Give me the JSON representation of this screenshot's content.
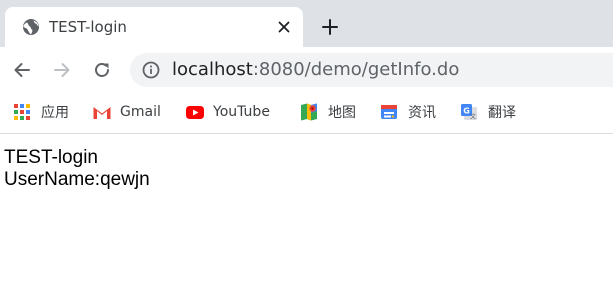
{
  "tab": {
    "title": "TEST-login",
    "favicon": "globe-icon",
    "close_icon": "close-icon",
    "new_tab_icon": "plus-icon"
  },
  "toolbar": {
    "back_icon": "back-arrow-icon",
    "forward_icon": "forward-arrow-icon",
    "reload_icon": "reload-icon",
    "info_icon": "info-icon",
    "url_host": "localhost",
    "url_rest": ":8080/demo/getInfo.do"
  },
  "bookmarks": [
    {
      "label": "应用",
      "icon": "apps-grid-icon"
    },
    {
      "label": "Gmail",
      "icon": "gmail-icon"
    },
    {
      "label": "YouTube",
      "icon": "youtube-icon"
    },
    {
      "label": "地图",
      "icon": "maps-icon"
    },
    {
      "label": "资讯",
      "icon": "news-icon"
    },
    {
      "label": "翻译",
      "icon": "translate-icon"
    }
  ],
  "page": {
    "line1": "TEST-login",
    "line2": "UserName:qewjn"
  },
  "colors": {
    "tabstrip_bg": "#dee1e6",
    "omnibox_bg": "#f1f3f4",
    "text": "#000000"
  }
}
